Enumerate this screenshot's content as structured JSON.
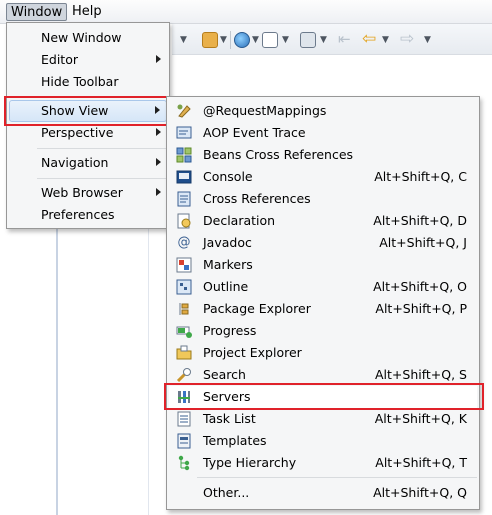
{
  "menubar": {
    "window_label": "Window",
    "help_label": "Help"
  },
  "toolbar": {
    "icons": [
      "open-folder-icon",
      "globe-icon",
      "new-file-icon",
      "paste-icon",
      "back-icon",
      "forward-icon"
    ]
  },
  "window_menu": {
    "items": [
      {
        "label": "New Window"
      },
      {
        "label": "Editor",
        "submenu": true
      },
      {
        "label": "Hide Toolbar"
      },
      {
        "label": "Show View",
        "submenu": true,
        "highlighted": true
      },
      {
        "label": "Perspective",
        "submenu": true
      },
      {
        "label": "Navigation",
        "submenu": true
      },
      {
        "label": "Web Browser",
        "submenu": true
      },
      {
        "label": "Preferences"
      }
    ]
  },
  "show_view_menu": {
    "items": [
      {
        "label": "@RequestMappings",
        "shortcut": "",
        "icon": "request-mappings-icon"
      },
      {
        "label": "AOP Event Trace",
        "shortcut": "",
        "icon": "aop-event-trace-icon"
      },
      {
        "label": "Beans Cross References",
        "shortcut": "",
        "icon": "beans-icon"
      },
      {
        "label": "Console",
        "shortcut": "Alt+Shift+Q, C",
        "icon": "console-icon"
      },
      {
        "label": "Cross References",
        "shortcut": "",
        "icon": "cross-references-icon"
      },
      {
        "label": "Declaration",
        "shortcut": "Alt+Shift+Q, D",
        "icon": "declaration-icon"
      },
      {
        "label": "Javadoc",
        "shortcut": "Alt+Shift+Q, J",
        "icon": "javadoc-icon"
      },
      {
        "label": "Markers",
        "shortcut": "",
        "icon": "markers-icon"
      },
      {
        "label": "Outline",
        "shortcut": "Alt+Shift+Q, O",
        "icon": "outline-icon"
      },
      {
        "label": "Package Explorer",
        "shortcut": "Alt+Shift+Q, P",
        "icon": "package-explorer-icon"
      },
      {
        "label": "Progress",
        "shortcut": "",
        "icon": "progress-icon"
      },
      {
        "label": "Project Explorer",
        "shortcut": "",
        "icon": "project-explorer-icon"
      },
      {
        "label": "Search",
        "shortcut": "Alt+Shift+Q, S",
        "icon": "search-icon"
      },
      {
        "label": "Servers",
        "shortcut": "",
        "icon": "servers-icon",
        "highlighted": true
      },
      {
        "label": "Task List",
        "shortcut": "Alt+Shift+Q, K",
        "icon": "task-list-icon"
      },
      {
        "label": "Templates",
        "shortcut": "",
        "icon": "templates-icon"
      },
      {
        "label": "Type Hierarchy",
        "shortcut": "Alt+Shift+Q, T",
        "icon": "type-hierarchy-icon"
      },
      {
        "label": "Other...",
        "shortcut": "Alt+Shift+Q, Q",
        "icon": ""
      }
    ]
  },
  "colors": {
    "highlight_box": "#e0222a",
    "menu_background": "#f5f6f7",
    "hover_fill": "#d6e6f8"
  }
}
